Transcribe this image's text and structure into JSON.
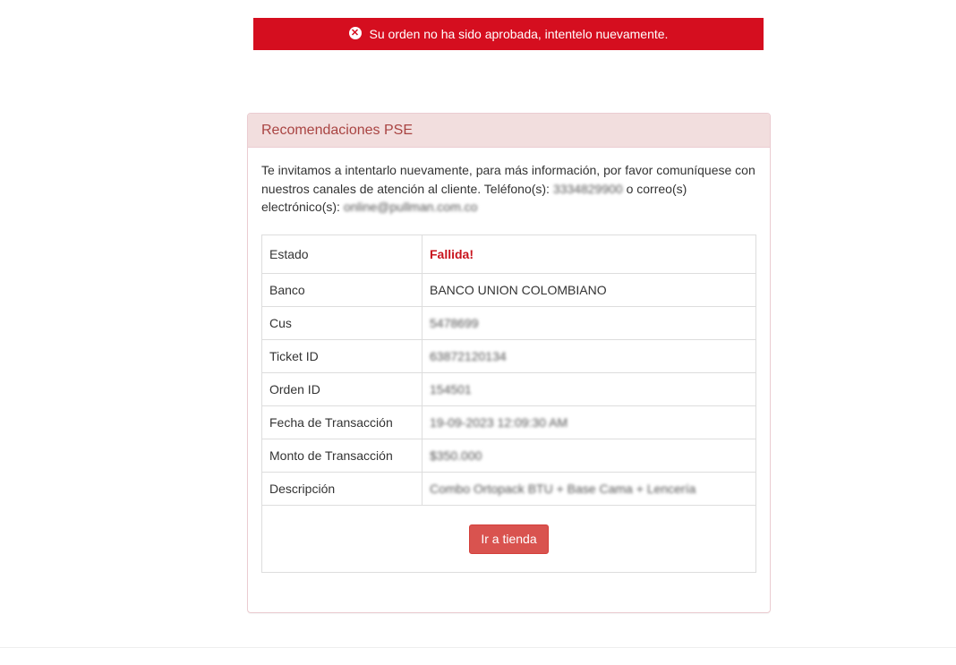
{
  "alert": {
    "icon": "close-circle-icon",
    "message": "Su orden no ha sido aprobada, intentelo nuevamente.",
    "color": "#d50e1f"
  },
  "panel": {
    "title": "Recomendaciones PSE",
    "intro_text": "Te invitamos a intentarlo nuevamente, para más información, por favor comuníquese con nuestros canales de atención al cliente. Teléfono(s): ",
    "phone": "3334829900",
    "intro_middle": " o correo(s) electrónico(s): ",
    "email": "online@pullman.com.co"
  },
  "details": {
    "rows": [
      {
        "label": "Estado",
        "value": "Fallida!"
      },
      {
        "label": "Banco",
        "value": "BANCO UNION COLOMBIANO"
      },
      {
        "label": "Cus",
        "value": "5478699"
      },
      {
        "label": "Ticket ID",
        "value": "63872120134"
      },
      {
        "label": "Orden ID",
        "value": "154501"
      },
      {
        "label": "Fecha de Transacción",
        "value": "19-09-2023 12:09:30 AM"
      },
      {
        "label": "Monto de Transacción",
        "value": "$350.000"
      },
      {
        "label": "Descripción",
        "value": "Combo Ortopack BTU + Base Cama + Lencería"
      }
    ],
    "button_label": "Ir a tienda"
  }
}
